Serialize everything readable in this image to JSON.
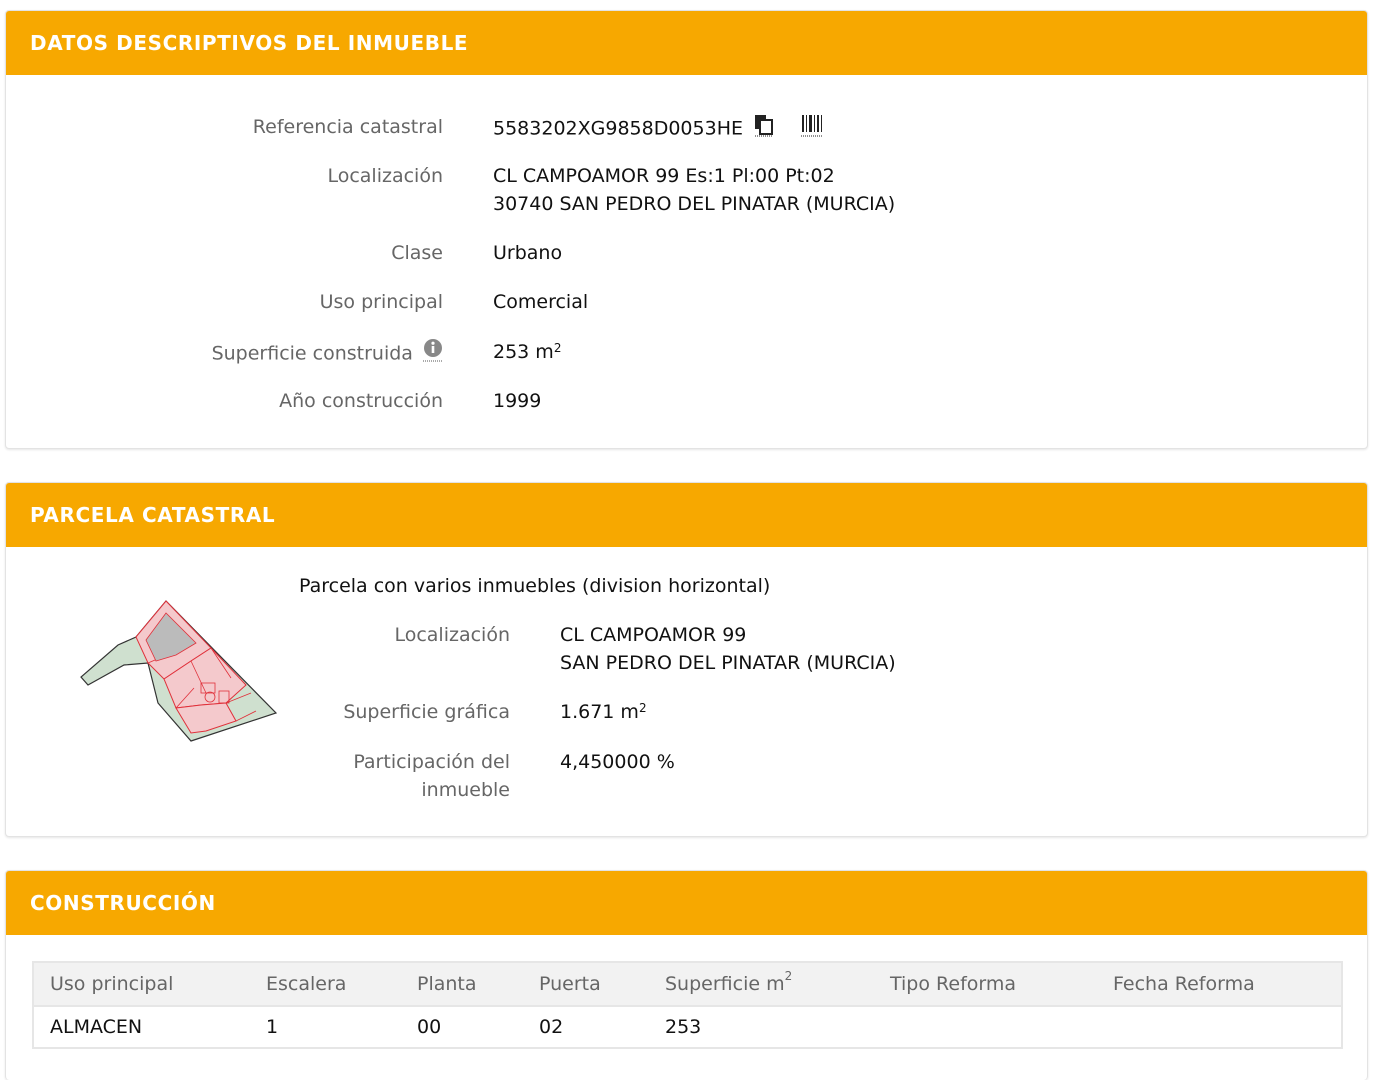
{
  "datos": {
    "title": "DATOS DESCRIPTIVOS DEL INMUEBLE",
    "ref_label": "Referencia catastral",
    "ref_value": "5583202XG9858D0053HE",
    "loc_label": "Localización",
    "loc_line1": "CL CAMPOAMOR 99 Es:1 Pl:00 Pt:02",
    "loc_line2": "30740 SAN PEDRO DEL PINATAR (MURCIA)",
    "clase_label": "Clase",
    "clase_value": "Urbano",
    "uso_label": "Uso principal",
    "uso_value": "Comercial",
    "sup_label": "Superficie construida",
    "sup_value": "253 m",
    "sup_unit_exp": "2",
    "anio_label": "Año construcción",
    "anio_value": "1999"
  },
  "parcela": {
    "title": "PARCELA CATASTRAL",
    "heading": "Parcela con varios inmuebles (division horizontal)",
    "loc_label": "Localización",
    "loc_line1": "CL CAMPOAMOR 99",
    "loc_line2": "SAN PEDRO DEL PINATAR (MURCIA)",
    "sup_label": "Superficie gráfica",
    "sup_value": "1.671 m",
    "sup_unit_exp": "2",
    "part_label_line1": "Participación del",
    "part_label_line2": "inmueble",
    "part_value": "4,450000 %"
  },
  "construccion": {
    "title": "CONSTRUCCIÓN",
    "headers": [
      "Uso principal",
      "Escalera",
      "Planta",
      "Puerta",
      "Superficie m",
      "Tipo Reforma",
      "Fecha Reforma"
    ],
    "sup_header_exp": "2",
    "rows": [
      [
        "ALMACEN",
        "1",
        "00",
        "02",
        "253",
        "",
        ""
      ]
    ]
  },
  "colors": {
    "header": "#f7a800",
    "label": "#666666",
    "value": "#111111"
  },
  "icons": {
    "copy": "copy-icon",
    "barcode": "barcode-icon",
    "info": "info-icon"
  }
}
